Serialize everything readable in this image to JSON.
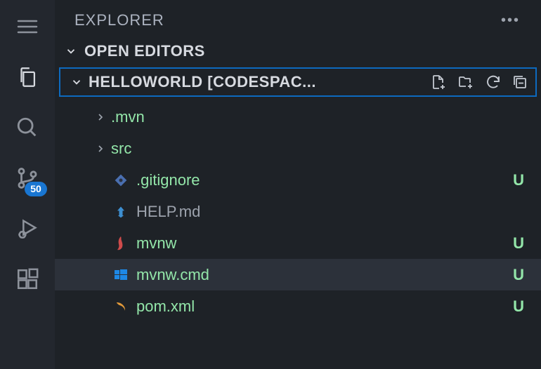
{
  "panel": {
    "title": "EXPLORER"
  },
  "sections": {
    "openEditors": "OPEN EDITORS",
    "workspace": "HELLOWORLD [CODESPAC..."
  },
  "sourceControlBadge": "50",
  "tree": {
    "items": [
      {
        "name": ".mvn",
        "type": "folder",
        "status": "dot"
      },
      {
        "name": "src",
        "type": "folder",
        "status": "dot"
      },
      {
        "name": ".gitignore",
        "type": "file",
        "color": "green",
        "status": "U"
      },
      {
        "name": "HELP.md",
        "type": "file",
        "color": "gray",
        "status": ""
      },
      {
        "name": "mvnw",
        "type": "file",
        "color": "green",
        "status": "U"
      },
      {
        "name": "mvnw.cmd",
        "type": "file",
        "color": "green",
        "status": "U",
        "selected": true
      },
      {
        "name": "pom.xml",
        "type": "file",
        "color": "green",
        "status": "U"
      }
    ]
  }
}
